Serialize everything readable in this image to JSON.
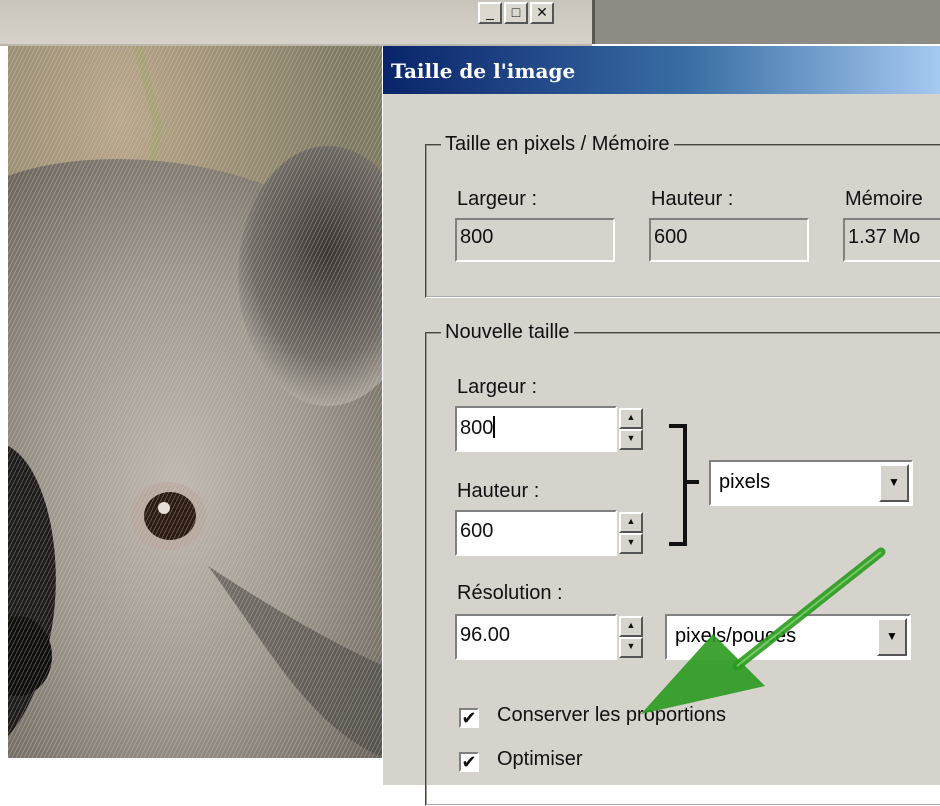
{
  "window_buttons": {
    "minimize": "_",
    "maximize": "□",
    "close": "✕"
  },
  "dialog": {
    "title": "Taille de l'image",
    "pixel_group": {
      "legend": "Taille en pixels / Mémoire",
      "width_label": "Largeur :",
      "width_value": "800",
      "height_label": "Hauteur :",
      "height_value": "600",
      "memory_label": "Mémoire",
      "memory_value": "1.37 Mo"
    },
    "new_size_group": {
      "legend": "Nouvelle taille",
      "width_label": "Largeur :",
      "width_value": "800",
      "height_label": "Hauteur :",
      "height_value": "600",
      "unit_value": "pixels",
      "resolution_label": "Résolution :",
      "resolution_value": "96.00",
      "resolution_unit": "pixels/pouces",
      "keep_proportions_label": "Conserver les proportions",
      "keep_proportions_checked": true,
      "optimize_label": "Optimiser",
      "optimize_checked": true
    }
  },
  "icons": {
    "spin_up": "▲",
    "spin_down": "▼",
    "dropdown": "▼",
    "check": "✔"
  },
  "colors": {
    "titlebar_start": "#0a246a",
    "arrow": "#2a9a1e",
    "dialog_bg": "#d6d3cd"
  }
}
